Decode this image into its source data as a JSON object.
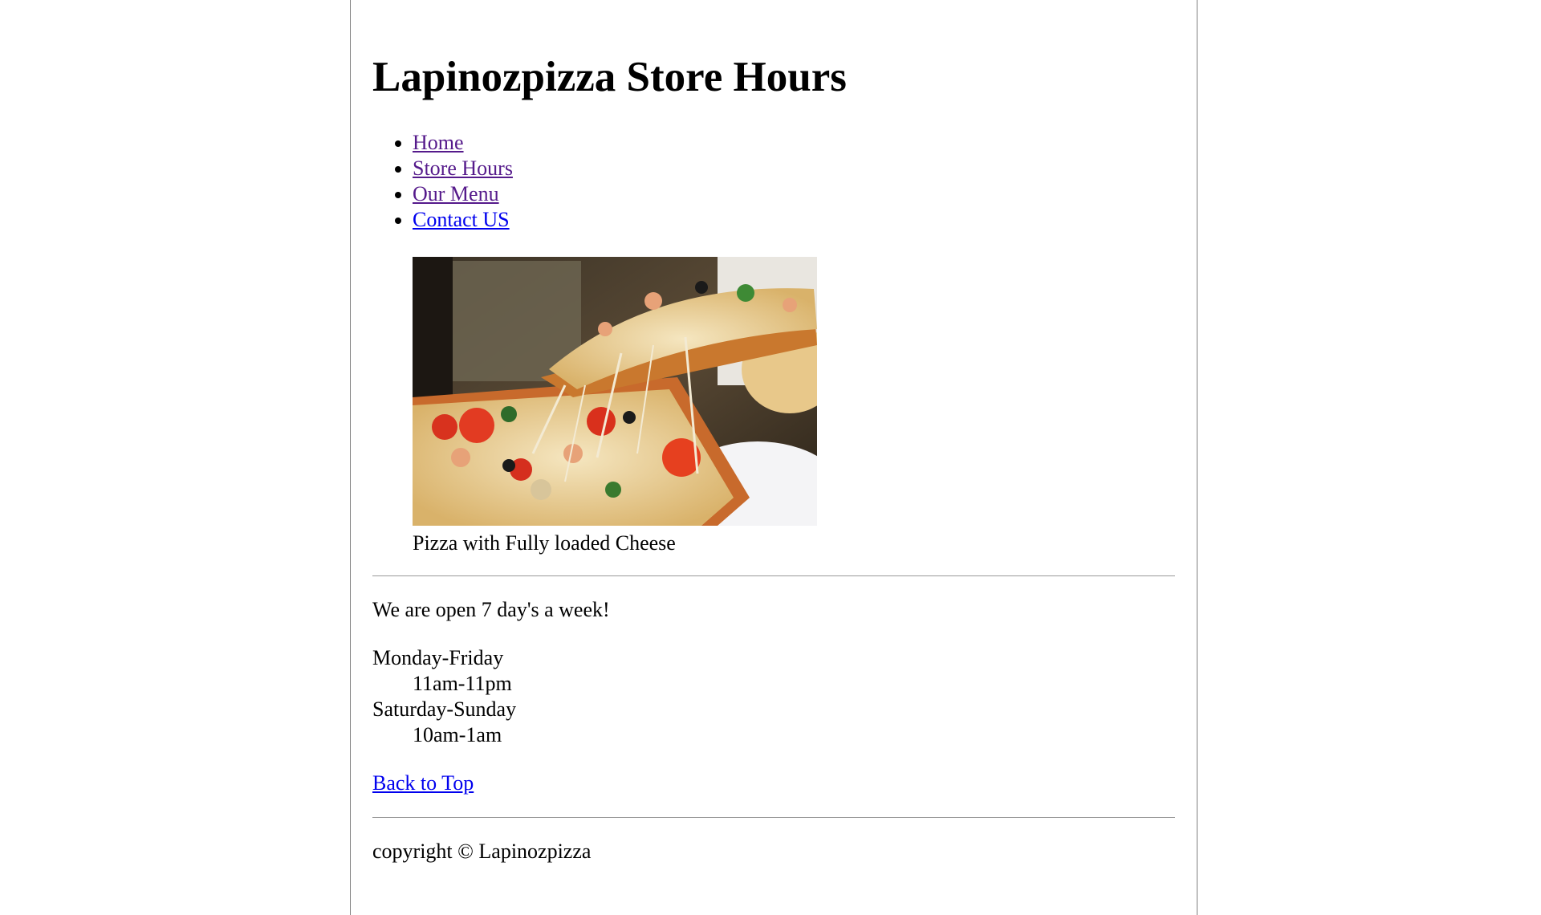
{
  "header": {
    "title": "Lapinozpizza Store Hours"
  },
  "nav": {
    "items": [
      {
        "label": "Home",
        "visited": true
      },
      {
        "label": "Store Hours",
        "visited": true
      },
      {
        "label": "Our Menu",
        "visited": true
      },
      {
        "label": "Contact US",
        "visited": false
      }
    ]
  },
  "figure": {
    "image_name": "pizza-photo",
    "caption": "Pizza with Fully loaded Cheese"
  },
  "main": {
    "open_text": "We are open 7 day's a week!",
    "hours": [
      {
        "days": "Monday-Friday",
        "time": "11am-11pm"
      },
      {
        "days": "Saturday-Sunday",
        "time": "10am-1am"
      }
    ],
    "back_to_top": "Back to Top"
  },
  "footer": {
    "copyright": "copyright © Lapinozpizza"
  },
  "colors": {
    "link": "#0000ee",
    "visited_link": "#551a8b",
    "border": "#808080"
  }
}
